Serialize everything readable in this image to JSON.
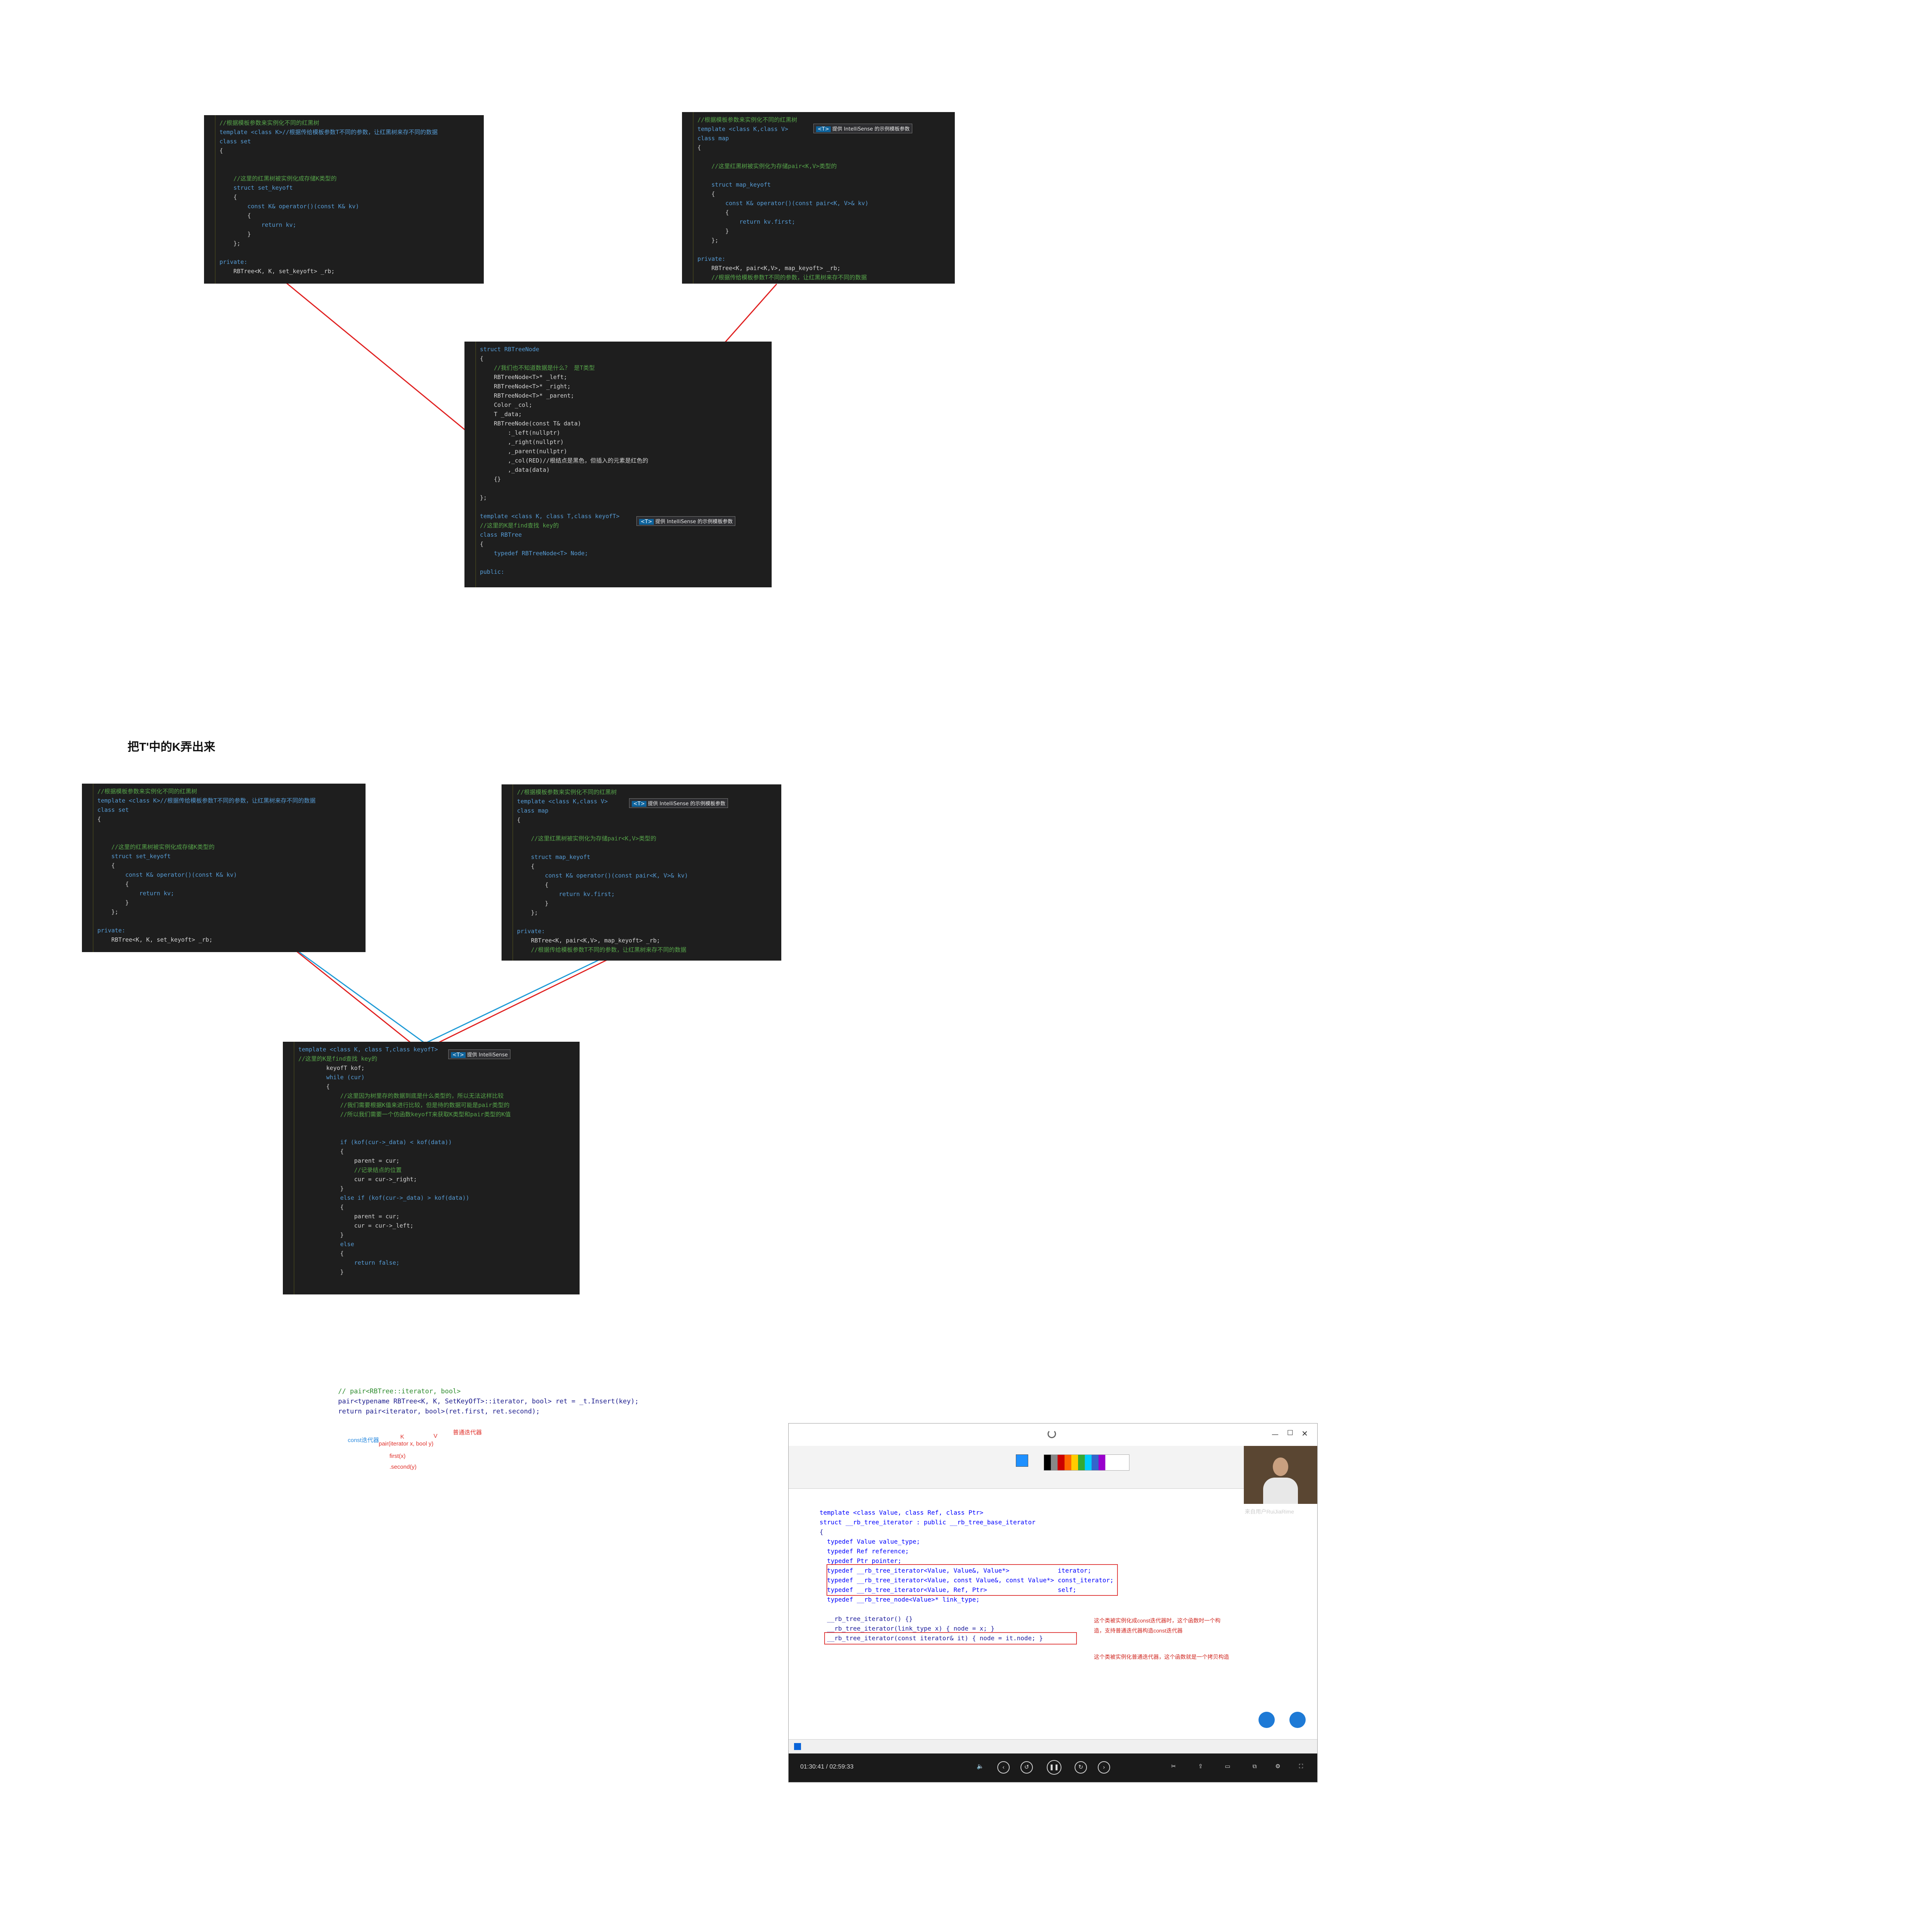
{
  "section_title": "把T'中的K弄出来",
  "shot_set_top": {
    "lines": [
      "//根据模板参数来实例化不同的红黑树",
      "template <class K>//根据传给模板参数T不同的参数，让红黑树来存不同的数据",
      "class set",
      "{",
      "",
      "",
      "    //这里的红黑树被实例化成存储K类型的",
      "    struct set_keyoft",
      "    {",
      "        const K& operator()(const K& kv)",
      "        {",
      "            return kv;",
      "        }",
      "    };",
      "",
      "private:",
      "    RBTree<K, K, set_keyoft> _rb;"
    ]
  },
  "shot_map_top": {
    "tip_tag": "<T>",
    "tip_text": "提供 IntelliSense 的示例模板参数",
    "lines": [
      "//根据模板参数来实例化不同的红黑树",
      "template <class K,class V>",
      "class map",
      "{",
      "",
      "    //这里红黑树被实例化为存储pair<K,V>类型的",
      "",
      "    struct map_keyoft",
      "    {",
      "        const K& operator()(const pair<K, V>& kv)",
      "        {",
      "            return kv.first;",
      "        }",
      "    };",
      "",
      "private:",
      "    RBTree<K, pair<K,V>, map_keyoft> _rb;",
      "    //根据传给模板参数T不同的参数，让红黑树来存不同的数据"
    ]
  },
  "shot_node": {
    "tip_tag": "<T>",
    "tip_text": "提供 IntelliSense 的示例模板参数",
    "lines": [
      "struct RBTreeNode",
      "{",
      "    //我们也不知道数据是什么？ 是T类型",
      "    RBTreeNode<T>* _left;",
      "    RBTreeNode<T>* _right;",
      "    RBTreeNode<T>* _parent;",
      "    Color _col;",
      "    T _data;",
      "    RBTreeNode(const T& data)",
      "        :_left(nullptr)",
      "        ,_right(nullptr)",
      "        ,_parent(nullptr)",
      "        ,_col(RED)//根结点是黑色，但插入的元素是红色的",
      "        ,_data(data)",
      "    {}",
      "",
      "};",
      "",
      "template <class K, class T,class keyofT>",
      "//这里的K是find查找 key的",
      "class RBTree",
      "{",
      "    typedef RBTreeNode<T> Node;",
      "",
      "public:"
    ]
  },
  "shot_set_bottom": {
    "lines": [
      "//根据模板参数来实例化不同的红黑树",
      "template <class K>//根据传给模板参数T不同的参数，让红黑树来存不同的数据",
      "class set",
      "{",
      "",
      "",
      "    //这里的红黑树被实例化成存储K类型的",
      "    struct set_keyoft",
      "    {",
      "        const K& operator()(const K& kv)",
      "        {",
      "            return kv;",
      "        }",
      "    };",
      "",
      "private:",
      "    RBTree<K, K, set_keyoft> _rb;"
    ]
  },
  "shot_map_bottom": {
    "tip_tag": "<T>",
    "tip_text": "提供 IntelliSense 的示例模板参数",
    "lines": [
      "//根据模板参数来实例化不同的红黑树",
      "template <class K,class V>",
      "class map",
      "{",
      "",
      "    //这里红黑树被实例化为存储pair<K,V>类型的",
      "",
      "    struct map_keyoft",
      "    {",
      "        const K& operator()(const pair<K, V>& kv)",
      "        {",
      "            return kv.first;",
      "        }",
      "    };",
      "",
      "private:",
      "    RBTree<K, pair<K,V>, map_keyoft> _rb;",
      "    //根据传给模板参数T不同的参数，让红黑树来存不同的数据"
    ]
  },
  "shot_tree": {
    "tip_tag": "<T>",
    "tip_text": "提供 IntelliSense",
    "lines": [
      "template <class K, class T,class keyofT>",
      "//这里的K是find查找 key的",
      "        keyofT kof;",
      "        while (cur)",
      "        {",
      "            //这里因为树里存的数据到底是什么类型的，所以无法这样比较",
      "            //我们需要根据K值来进行比较，但是待的数据可能是pair类型的",
      "            //所以我们需要一个仿函数keyofT来获取K类型和pair类型的K值",
      "",
      "",
      "            if (kof(cur->_data) < kof(data))",
      "            {",
      "                parent = cur;",
      "                //记录结点的位置",
      "                cur = cur->_right;",
      "            }",
      "            else if (kof(cur->_data) > kof(data))",
      "            {",
      "                parent = cur;",
      "                cur = cur->_left;",
      "            }",
      "            else",
      "            {",
      "                return false;",
      "            }"
    ]
  },
  "snippet": {
    "lines": [
      "// pair<RBTree::iterator, bool>",
      "pair<typename RBTree<K, K, SetKeyOfT>::iterator, bool> ret = _t.Insert(key);",
      "return pair<iterator, bool>(ret.first, ret.second);"
    ],
    "ann_normal_iter": "普通迭代器",
    "ann_const_iter": "const迭代器",
    "ann_pair": "pair(iterator x, bool y)",
    "ann_k": "K",
    "ann_v": "V",
    "ann_first": "first(x)",
    "ann_second": ".second(y)"
  },
  "video": {
    "time": "01:30:41 / 02:59:33",
    "watermark": "来自用户RuiJiaRime",
    "lines": [
      "template <class Value, class Ref, class Ptr>",
      "struct __rb_tree_iterator : public __rb_tree_base_iterator",
      "{",
      "  typedef Value value_type;",
      "  typedef Ref reference;",
      "  typedef Ptr pointer;",
      "  typedef __rb_tree_iterator<Value, Value&, Value*>             iterator;",
      "  typedef __rb_tree_iterator<Value, const Value&, const Value*> const_iterator;",
      "  typedef __rb_tree_iterator<Value, Ref, Ptr>                   self;",
      "  typedef __rb_tree_node<Value>* link_type;",
      "",
      "  __rb_tree_iterator() {}",
      "  __rb_tree_iterator(link_type x) { node = x; }",
      "  __rb_tree_iterator(const iterator& it) { node = it.node; }"
    ],
    "note1": "这个类被实例化成const迭代器时，这个函数时一个构",
    "note2": "造，支持普通迭代器构造const迭代器",
    "note3": "这个类被实例化普通迭代器，这个函数就是一个拷贝构造"
  },
  "colors": {
    "editor_bg": "#1e1e1e",
    "arrow_red": "#e02020",
    "arrow_blue": "#1e9ad6"
  }
}
